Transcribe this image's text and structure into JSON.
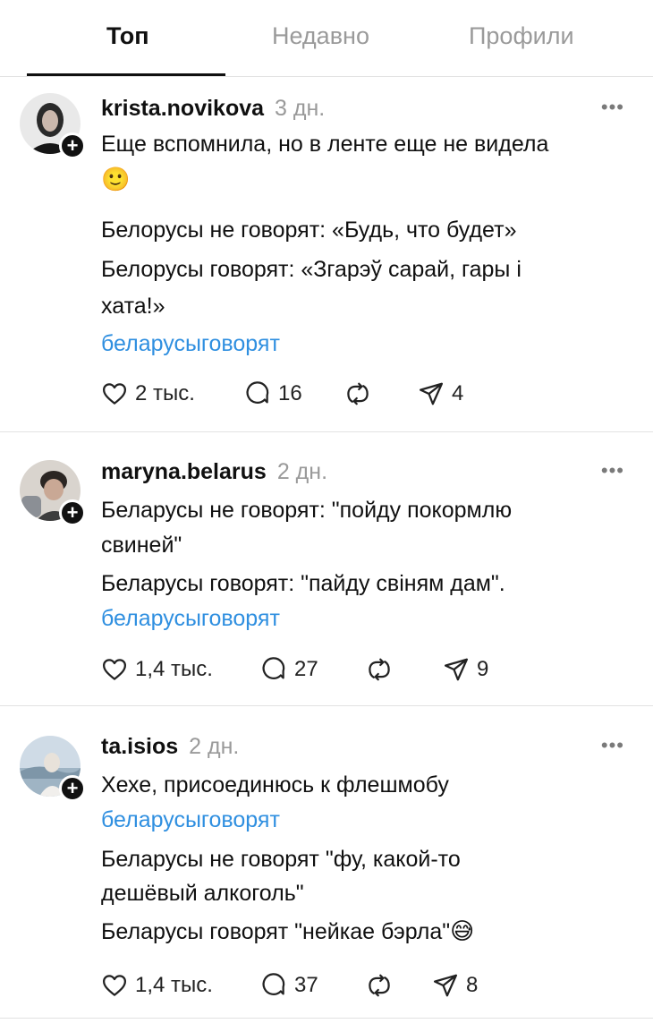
{
  "tabs": [
    {
      "label": "Топ",
      "active": true
    },
    {
      "label": "Недавно",
      "active": false
    },
    {
      "label": "Профили",
      "active": false
    }
  ],
  "posts": [
    {
      "username": "krista.novikova",
      "time": "3 дн.",
      "lines": [
        "Еще вспомнила, но в ленте еще не видела",
        "🙂",
        "Белорусы не говорят: «Будь, что будет»",
        "Белорусы говорят: «Згарэў сарай, гары і",
        "хата!»",
        "беларусыговорят"
      ],
      "likes": "2 тыс.",
      "comments": "16",
      "shares": "4"
    },
    {
      "username": "maryna.belarus",
      "time": "2 дн.",
      "lines": [
        "Беларусы не говорят: \"пойду покормлю",
        "свиней\"",
        "Беларусы говорят: \"пайду свіням дам\".",
        "беларусыговорят"
      ],
      "likes": "1,4 тыс.",
      "comments": "27",
      "shares": "9"
    },
    {
      "username": "ta.isios",
      "time": "2 дн.",
      "lines": [
        "Хехе, присоединюсь к флешмобу",
        "беларусыговорят",
        "Беларусы не говорят \"фу, какой-то",
        "дешёвый алкоголь\"",
        "Беларусы говорят \"нейкае бэрла\"",
        "😅"
      ],
      "likes": "1,4 тыс.",
      "comments": "37",
      "shares": "8"
    }
  ],
  "icons": {
    "like": "heart-icon",
    "comment": "comment-bubble-icon",
    "repost": "repost-icon",
    "share": "send-icon",
    "more": "more-dots-icon",
    "follow": "plus-badge-icon"
  },
  "colors": {
    "hashtag": "#2f8fe0",
    "muted": "#9a9a9a",
    "text": "#101010"
  }
}
